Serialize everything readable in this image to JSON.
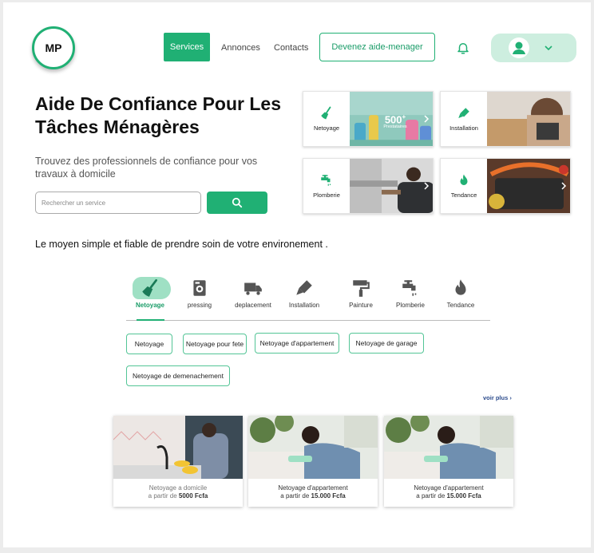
{
  "header": {
    "logo_text": "MP",
    "nav": {
      "services": "Services",
      "annonces": "Annonces",
      "contacts": "Contacts"
    },
    "cta": "Devenez aide-menager"
  },
  "hero": {
    "title": "Aide De Confiance Pour Les Tâches Ménagères",
    "subtitle": "Trouvez des professionnels de confiance pour vos travaux à domicile",
    "search_placeholder": "Rechercher un service"
  },
  "categories": [
    {
      "label": "Netoyage",
      "icon": "broom-icon",
      "promo_number": "500",
      "promo_sup": "+",
      "promo_text": "Prestataires"
    },
    {
      "label": "Installation",
      "icon": "glue-icon"
    },
    {
      "label": "Plomberie",
      "icon": "faucet-icon"
    },
    {
      "label": "Tendance",
      "icon": "fire-icon"
    }
  ],
  "tagline": "Le moyen simple et fiable de prendre soin de votre environement .",
  "tabs": [
    {
      "label": "Netoyage",
      "icon": "broom-icon"
    },
    {
      "label": "pressing",
      "icon": "washing-machine-icon"
    },
    {
      "label": "deplacement",
      "icon": "truck-icon"
    },
    {
      "label": "Installation",
      "icon": "glue-icon"
    },
    {
      "label": "Painture",
      "icon": "paint-roller-icon"
    },
    {
      "label": "Plomberie",
      "icon": "faucet-icon"
    },
    {
      "label": "Tendance",
      "icon": "fire-icon"
    }
  ],
  "active_tab": "Netoyage",
  "chips": [
    "Netoyage",
    "Netoyage pour fete",
    "Netoyage d'appartement",
    "Netoyage de garage",
    "Netoyage de demenachement"
  ],
  "voir_plus": "voir plus",
  "products": [
    {
      "line1": "Netoyage a domicile",
      "line2_prefix": "a partir de ",
      "price": "5000 Fcfa"
    },
    {
      "line1": "Netoyage d'appartement",
      "line2_prefix": "a partir de ",
      "price": "15.000 Fcfa"
    },
    {
      "line1": "Netoyage d'appartement",
      "line2_prefix": "a partir de ",
      "price": "15.000 Fcfa"
    }
  ],
  "colors": {
    "brand": "#20b074",
    "brand_light": "#cdeedf",
    "link": "#2b4b8c"
  }
}
